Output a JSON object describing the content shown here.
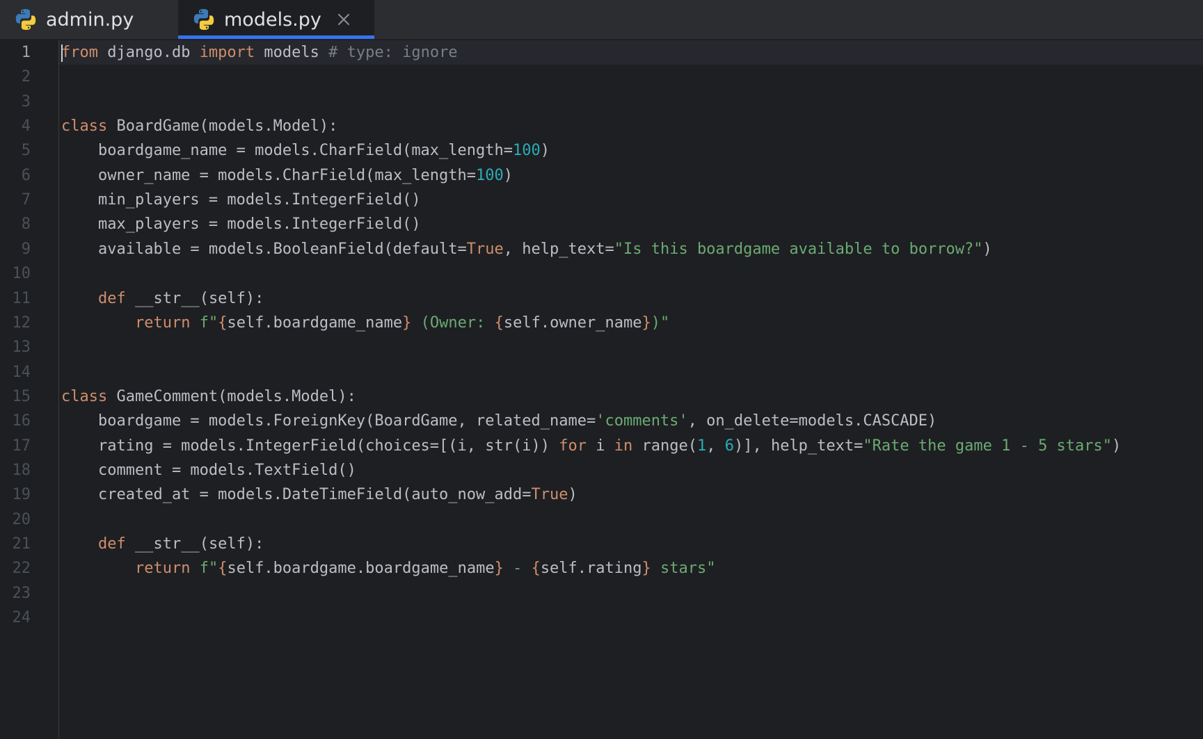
{
  "tabs": [
    {
      "label": "admin.py",
      "icon": "python-icon",
      "active": false
    },
    {
      "label": "models.py",
      "icon": "python-icon",
      "active": true,
      "closable": true
    }
  ],
  "colors": {
    "keyword": "#cf8e6d",
    "string": "#6aab73",
    "number": "#2aacb8",
    "comment": "#7a7e85",
    "default": "#bcbec4",
    "accent": "#3574f0"
  },
  "editor": {
    "current_line": 1,
    "lines": [
      [
        {
          "t": "kw",
          "v": "from"
        },
        {
          "t": "",
          "v": " django.db "
        },
        {
          "t": "kw",
          "v": "import"
        },
        {
          "t": "",
          "v": " models "
        },
        {
          "t": "cmt",
          "v": "# type: ignore"
        }
      ],
      [],
      [],
      [
        {
          "t": "kw",
          "v": "class"
        },
        {
          "t": "",
          "v": " BoardGame(models.Model):"
        }
      ],
      [
        {
          "t": "",
          "v": "    boardgame_name = models.CharField(max_length="
        },
        {
          "t": "num",
          "v": "100"
        },
        {
          "t": "",
          "v": ")"
        }
      ],
      [
        {
          "t": "",
          "v": "    owner_name = models.CharField(max_length="
        },
        {
          "t": "num",
          "v": "100"
        },
        {
          "t": "",
          "v": ")"
        }
      ],
      [
        {
          "t": "",
          "v": "    min_players = models.IntegerField()"
        }
      ],
      [
        {
          "t": "",
          "v": "    max_players = models.IntegerField()"
        }
      ],
      [
        {
          "t": "",
          "v": "    available = models.BooleanField(default="
        },
        {
          "t": "kw",
          "v": "True"
        },
        {
          "t": "",
          "v": ", help_text="
        },
        {
          "t": "str",
          "v": "\"Is this boardgame available to borrow?\""
        },
        {
          "t": "",
          "v": ")"
        }
      ],
      [],
      [
        {
          "t": "",
          "v": "    "
        },
        {
          "t": "kw",
          "v": "def"
        },
        {
          "t": "",
          "v": " __str__(self):"
        }
      ],
      [
        {
          "t": "",
          "v": "        "
        },
        {
          "t": "kw",
          "v": "return"
        },
        {
          "t": "",
          "v": " "
        },
        {
          "t": "str",
          "v": "f\""
        },
        {
          "t": "brace",
          "v": "{"
        },
        {
          "t": "",
          "v": "self.boardgame_name"
        },
        {
          "t": "brace",
          "v": "}"
        },
        {
          "t": "str",
          "v": " (Owner: "
        },
        {
          "t": "brace",
          "v": "{"
        },
        {
          "t": "",
          "v": "self.owner_name"
        },
        {
          "t": "brace",
          "v": "}"
        },
        {
          "t": "str",
          "v": ")\""
        }
      ],
      [],
      [],
      [
        {
          "t": "kw",
          "v": "class"
        },
        {
          "t": "",
          "v": " GameComment(models.Model):"
        }
      ],
      [
        {
          "t": "",
          "v": "    boardgame = models.ForeignKey(BoardGame, related_name="
        },
        {
          "t": "str",
          "v": "'comments'"
        },
        {
          "t": "",
          "v": ", on_delete=models.CASCADE)"
        }
      ],
      [
        {
          "t": "",
          "v": "    rating = models.IntegerField(choices=[(i, str(i)) "
        },
        {
          "t": "kw",
          "v": "for"
        },
        {
          "t": "",
          "v": " i "
        },
        {
          "t": "kw",
          "v": "in"
        },
        {
          "t": "",
          "v": " range("
        },
        {
          "t": "num",
          "v": "1"
        },
        {
          "t": "",
          "v": ", "
        },
        {
          "t": "num",
          "v": "6"
        },
        {
          "t": "",
          "v": ")], help_text="
        },
        {
          "t": "str",
          "v": "\"Rate the game 1 - 5 stars\""
        },
        {
          "t": "",
          "v": ")"
        }
      ],
      [
        {
          "t": "",
          "v": "    comment = models.TextField()"
        }
      ],
      [
        {
          "t": "",
          "v": "    created_at = models.DateTimeField(auto_now_add="
        },
        {
          "t": "kw",
          "v": "True"
        },
        {
          "t": "",
          "v": ")"
        }
      ],
      [],
      [
        {
          "t": "",
          "v": "    "
        },
        {
          "t": "kw",
          "v": "def"
        },
        {
          "t": "",
          "v": " __str__(self):"
        }
      ],
      [
        {
          "t": "",
          "v": "        "
        },
        {
          "t": "kw",
          "v": "return"
        },
        {
          "t": "",
          "v": " "
        },
        {
          "t": "str",
          "v": "f\""
        },
        {
          "t": "brace",
          "v": "{"
        },
        {
          "t": "",
          "v": "self.boardgame.boardgame_name"
        },
        {
          "t": "brace",
          "v": "}"
        },
        {
          "t": "str",
          "v": " - "
        },
        {
          "t": "brace",
          "v": "{"
        },
        {
          "t": "",
          "v": "self.rating"
        },
        {
          "t": "brace",
          "v": "}"
        },
        {
          "t": "str",
          "v": " stars\""
        }
      ],
      [],
      []
    ]
  }
}
